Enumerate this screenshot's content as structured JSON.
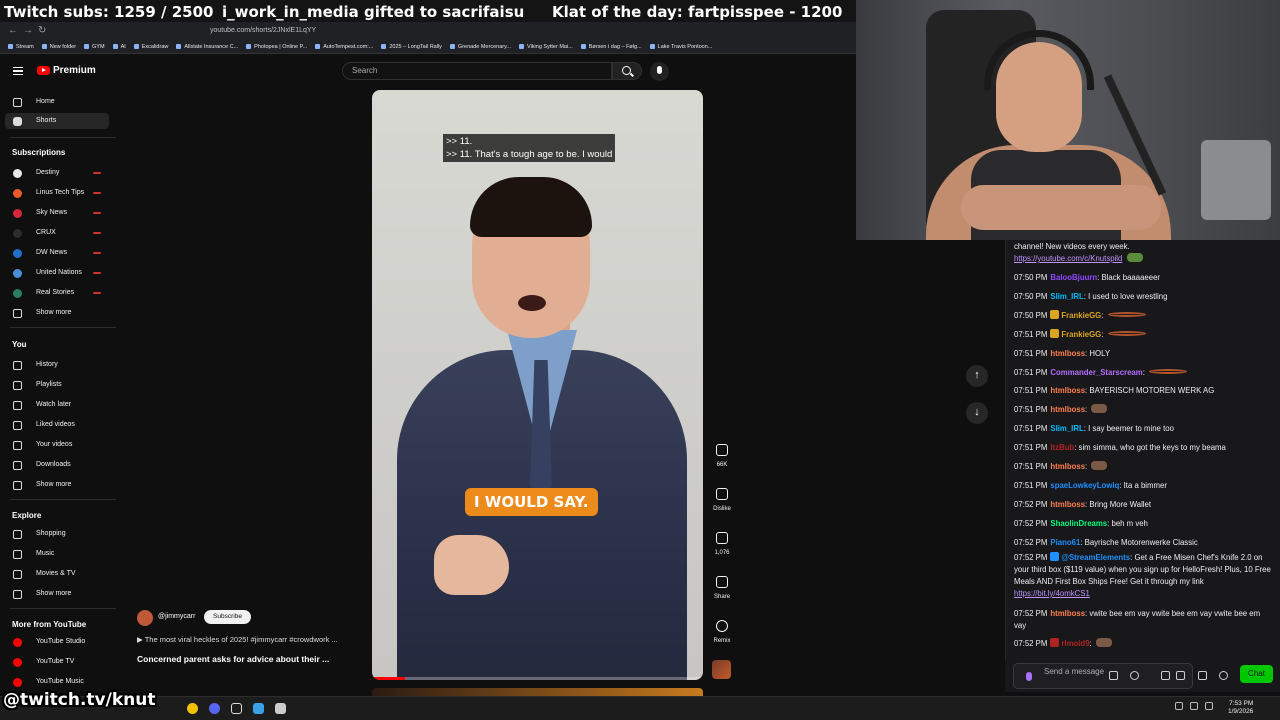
{
  "overlay": {
    "subs": "Twitch subs: 1259 / 2500",
    "gift": "i_work_in_media gifted to sacrifaisu",
    "klat": "Klat of the day: fartpisspee - 1200",
    "watermark": "@twitch.tv/knut"
  },
  "browser": {
    "url": "youtube.com/shorts/2JNxlE1LqYY",
    "bookmarks": [
      "Stream",
      "New folder",
      "GYM",
      "AI",
      "Excalidraw",
      "Allstate Insurance C...",
      "Photopea | Online P...",
      "AutoTempest.com:...",
      "2025 – LongTail Rally",
      "Grenade Mercenary...",
      "Viking Sytter Mai...",
      "Børsen i dag – Følg...",
      "Lake Travis Pontoon..."
    ]
  },
  "yt": {
    "brand": "Premium",
    "search_placeholder": "Search"
  },
  "sidebar": {
    "home": "Home",
    "shorts": "Shorts",
    "subscriptions_heading": "Subscriptions",
    "channels": [
      {
        "name": "Destiny",
        "color": "#e9e9e9"
      },
      {
        "name": "Linus Tech Tips",
        "color": "#e85b2a"
      },
      {
        "name": "Sky News",
        "color": "#d6283a"
      },
      {
        "name": "CRUX",
        "color": "#2d2d2d"
      },
      {
        "name": "DW News",
        "color": "#1f6fc9"
      },
      {
        "name": "United Nations",
        "color": "#4a90d9"
      },
      {
        "name": "Real Stories",
        "color": "#2a7f62"
      }
    ],
    "show_more": "Show more",
    "you_heading": "You",
    "you_items": [
      "History",
      "Playlists",
      "Watch later",
      "Liked videos",
      "Your videos",
      "Downloads"
    ],
    "explore_heading": "Explore",
    "explore_items": [
      "Shopping",
      "Music",
      "Movies & TV"
    ],
    "more_heading": "More from YouTube",
    "more_items": [
      "YouTube Studio",
      "YouTube TV",
      "YouTube Music"
    ]
  },
  "short": {
    "cc_line1": ">> 11.",
    "cc_line2": ">> 11. That's a tough age to be. I would",
    "caption": "I WOULD SAY.",
    "progress": 0.1,
    "channel": "@jimmycarr",
    "subscribe": "Subscribe",
    "description": "▶ The most viral heckles of 2025! #jimmycarr #crowdwork ...",
    "title": "Concerned parent asks for advice about their ..."
  },
  "actions": {
    "likes": "66K",
    "dislike": "Dislike",
    "comments": "1,076",
    "share": "Share",
    "remix": "Remix"
  },
  "chat": {
    "top_line": "channel! New videos every week.",
    "top_link": "https://youtube.com/c/Knutspild",
    "messages": [
      {
        "time": "07:50 PM",
        "user": "BalooBjuurn",
        "color": "#9147ff",
        "text": "Black baaaaeeer"
      },
      {
        "time": "07:50 PM",
        "user": "Slim_IRL",
        "color": "#00bfff",
        "text": "I used to love wrestling"
      },
      {
        "time": "07:50 PM",
        "user": "FrankieGG",
        "color": "#daa520",
        "text": ""
      },
      {
        "time": "07:51 PM",
        "user": "FrankieGG",
        "color": "#daa520",
        "text": ""
      },
      {
        "time": "07:51 PM",
        "user": "htmlboss",
        "color": "#ff7f50",
        "text": "HOLY"
      },
      {
        "time": "07:51 PM",
        "user": "Commander_Starscream",
        "color": "#b46dff",
        "text": ""
      },
      {
        "time": "07:51 PM",
        "user": "htmlboss",
        "color": "#ff7f50",
        "text": "BAYERISCH MOTOREN WERK AG"
      },
      {
        "time": "07:51 PM",
        "user": "htmlboss",
        "color": "#ff7f50",
        "text": ""
      },
      {
        "time": "07:51 PM",
        "user": "Slim_IRL",
        "color": "#00bfff",
        "text": "I say beemer to mine too"
      },
      {
        "time": "07:51 PM",
        "user": "ItzBub",
        "color": "#b22222",
        "text": "sim simma, who got the keys to my beama"
      },
      {
        "time": "07:51 PM",
        "user": "htmlboss",
        "color": "#ff7f50",
        "text": ""
      },
      {
        "time": "07:51 PM",
        "user": "spaeLowkeyLowiq",
        "color": "#1e90ff",
        "text": "Ita a bimmer"
      },
      {
        "time": "07:52 PM",
        "user": "htmlboss",
        "color": "#ff7f50",
        "text": "Bring More Wallet"
      },
      {
        "time": "07:52 PM",
        "user": "ShaolinDreams",
        "color": "#00ff7f",
        "text": "beh m veh"
      },
      {
        "time": "07:52 PM",
        "user": "Piano61",
        "color": "#1e90ff",
        "text": "Bayrische Motorenwerke Classic"
      }
    ],
    "promo": {
      "time": "07:52 PM",
      "user": "@StreamElements",
      "color": "#1e90ff",
      "text": "Get a Free Misen Chef's Knife 2.0 on your third box ($119 value) when you sign up for HelloFresh! Plus, 10 Free Meals AND First Box Ships Free! Get it through my link",
      "link": "https://bit.ly/4omkCS1"
    },
    "last": [
      {
        "time": "07:52 PM",
        "user": "htmlboss",
        "color": "#ff7f50",
        "text": "vwite bee em vay   vwite bee em vay   vwite bee em vay"
      },
      {
        "time": "07:52 PM",
        "user": "rlmoid9",
        "color": "#b22222",
        "text": ""
      }
    ],
    "placeholder": "Send a message",
    "chat_button": "Chat"
  },
  "taskbar": {
    "time": "7:53 PM",
    "date": "1/9/2026"
  }
}
